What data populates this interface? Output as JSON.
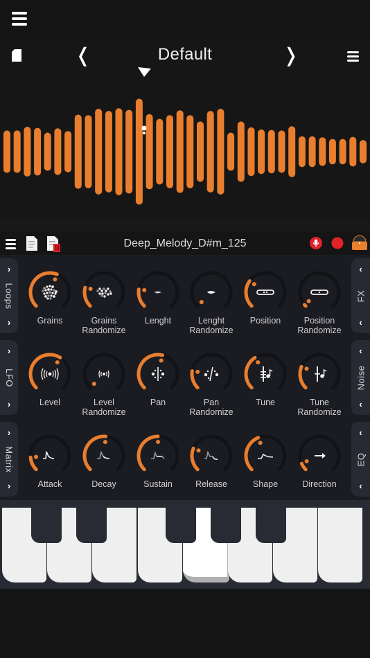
{
  "topbar": {
    "menu_icon": "hamburger-menu-icon"
  },
  "presetbar": {
    "file_icon": "file-icon",
    "prev_label": "❬",
    "title": "Default",
    "next_label": "❭",
    "menu_icon": "list-menu-icon"
  },
  "waveform": {
    "color": "#e97e2f",
    "playhead_position": 0.385,
    "amplitudes": [
      0.4,
      0.4,
      0.47,
      0.45,
      0.36,
      0.44,
      0.39,
      0.7,
      0.69,
      0.81,
      0.77,
      0.82,
      0.79,
      1.0,
      0.71,
      0.62,
      0.69,
      0.78,
      0.69,
      0.57,
      0.77,
      0.81,
      0.36,
      0.57,
      0.46,
      0.42,
      0.41,
      0.4,
      0.48,
      0.29,
      0.29,
      0.27,
      0.24,
      0.24,
      0.28,
      0.22
    ]
  },
  "toolbar": {
    "menu_icon": "menu-icon",
    "new_icon": "new-document-icon",
    "delete_icon": "delete-document-icon",
    "title": "Deep_Melody_D#m_125",
    "mic_icon": "microphone-icon",
    "record_icon": "record-icon",
    "library_icon": "library-bag-icon"
  },
  "colors": {
    "accent": "#e97e2f",
    "record": "#e0232a",
    "track": "#121317",
    "panel": "#1b1c22",
    "tab": "#272a32"
  },
  "rows": [
    {
      "left_tab": {
        "label": "Loops",
        "arrow": "›"
      },
      "right_tab": {
        "label": "FX",
        "arrow": "‹"
      },
      "knobs": [
        {
          "label1": "Grains",
          "label2": "",
          "value": 0.58,
          "icon": "grains-icon"
        },
        {
          "label1": "Grains",
          "label2": "Randomize",
          "value": 0.22,
          "icon": "grains-randomize-icon"
        },
        {
          "label1": "Lenght",
          "label2": "",
          "value": 0.2,
          "icon": "length-icon"
        },
        {
          "label1": "Lenght",
          "label2": "Randomize",
          "value": 0.0,
          "icon": "length-randomize-icon"
        },
        {
          "label1": "Position",
          "label2": "",
          "value": 0.3,
          "icon": "position-icon"
        },
        {
          "label1": "Position",
          "label2": "Randomize",
          "value": 0.02,
          "icon": "position-randomize-icon"
        }
      ]
    },
    {
      "left_tab": {
        "label": "LFO",
        "arrow": "›"
      },
      "right_tab": {
        "label": "Noise",
        "arrow": "‹"
      },
      "knobs": [
        {
          "label1": "Level",
          "label2": "",
          "value": 0.62,
          "icon": "level-icon"
        },
        {
          "label1": "Level",
          "label2": "Randomize",
          "value": 0.0,
          "icon": "level-randomize-icon"
        },
        {
          "label1": "Pan",
          "label2": "",
          "value": 0.55,
          "icon": "pan-icon"
        },
        {
          "label1": "Pan",
          "label2": "Randomize",
          "value": 0.2,
          "icon": "pan-randomize-icon"
        },
        {
          "label1": "Tune",
          "label2": "",
          "value": 0.38,
          "icon": "tune-icon"
        },
        {
          "label1": "Tune",
          "label2": "Randomize",
          "value": 0.25,
          "icon": "tune-randomize-icon"
        }
      ]
    },
    {
      "left_tab": {
        "label": "Matrix",
        "arrow": "›"
      },
      "right_tab": {
        "label": "EQ",
        "arrow": "‹"
      },
      "knobs": [
        {
          "label1": "Attack",
          "label2": "",
          "value": 0.15,
          "icon": "attack-envelope-icon"
        },
        {
          "label1": "Decay",
          "label2": "",
          "value": 0.52,
          "icon": "decay-envelope-icon"
        },
        {
          "label1": "Sustain",
          "label2": "",
          "value": 0.5,
          "icon": "sustain-envelope-icon"
        },
        {
          "label1": "Release",
          "label2": "",
          "value": 0.25,
          "icon": "release-envelope-icon"
        },
        {
          "label1": "Shape",
          "label2": "",
          "value": 0.42,
          "icon": "shape-icon"
        },
        {
          "label1": "Direction",
          "label2": "",
          "value": 0.08,
          "icon": "direction-arrow-icon"
        }
      ]
    }
  ],
  "keyboard": {
    "white_keys": 8,
    "pressed_white_key_index": 4
  }
}
